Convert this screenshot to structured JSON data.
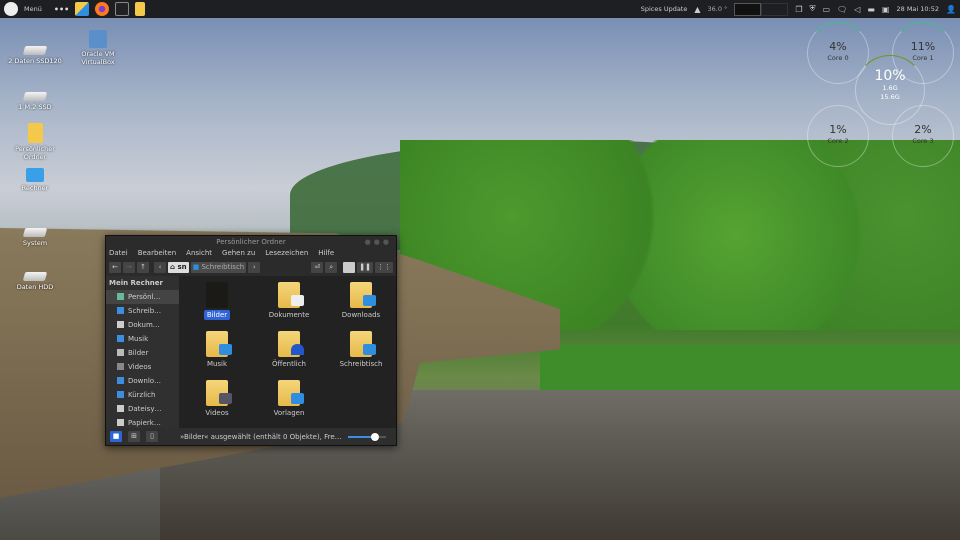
{
  "panel": {
    "menu_label": "Menü",
    "spices": "Spices Update",
    "temp": "36.0 °",
    "clock": "28 Mai 10:52"
  },
  "desktop": [
    {
      "label": "2 Daten SSD120",
      "icon": "drive-icon"
    },
    {
      "label": "Oracle VM VirtualBox",
      "icon": "virtualbox-icon"
    },
    {
      "label": "1 M.2 SSD",
      "icon": "drive-icon"
    },
    {
      "label": "Persönlicher Ordner",
      "icon": "home-folder-icon"
    },
    {
      "label": "Rechner",
      "icon": "computer-icon"
    },
    {
      "label": "System",
      "icon": "drive-icon"
    },
    {
      "label": "Daten HDD",
      "icon": "drive-icon"
    }
  ],
  "monitor": {
    "cores": [
      {
        "value": "4%",
        "label": "Core 0",
        "pct": 4
      },
      {
        "value": "11%",
        "label": "Core 1",
        "pct": 11
      },
      {
        "value": "1%",
        "label": "Core 2",
        "pct": 1
      },
      {
        "value": "2%",
        "label": "Core 3",
        "pct": 2
      }
    ],
    "total": "10%",
    "mem_used": "1.6G",
    "mem_total": "15.6G"
  },
  "window": {
    "title": "Persönlicher Ordner",
    "menu": [
      "Datei",
      "Bearbeiten",
      "Ansicht",
      "Gehen zu",
      "Lesezeichen",
      "Hilfe"
    ],
    "path": [
      "sn",
      "Schreibtisch"
    ],
    "sidebar_header": "Mein Rechner",
    "sidebar": [
      "Persönl…",
      "Schreib…",
      "Dokum…",
      "Musik",
      "Bilder",
      "Videos",
      "Downlo…",
      "Kürzlich",
      "Dateisy…",
      "Papierk…"
    ],
    "files": [
      "Bilder",
      "Dokumente",
      "Downloads",
      "Musik",
      "Öffentlich",
      "Schreibtisch",
      "Videos",
      "Vorlagen"
    ],
    "status": "»Bilder« ausgewählt (enthält 0 Objekte), Fre…",
    "zoom_level": 70
  }
}
